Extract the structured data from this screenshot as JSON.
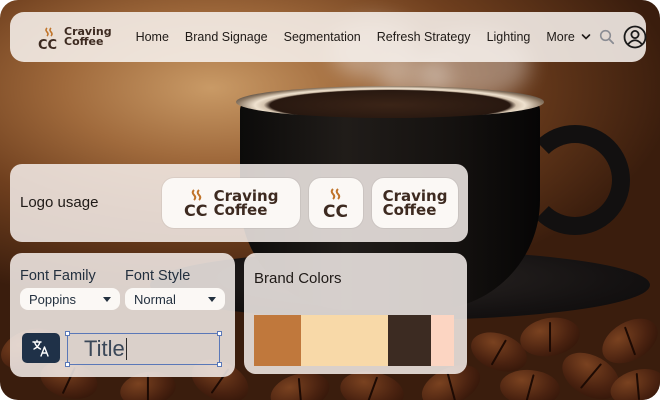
{
  "brand": {
    "logo_line1": "Craving",
    "logo_line2": "Coffee",
    "logo_initials": "CC"
  },
  "nav": {
    "links": [
      "Home",
      "Brand Signage",
      "Segmentation",
      "Refresh Strategy",
      "Lighting"
    ],
    "more_label": "More"
  },
  "logo_usage": {
    "title": "Logo usage"
  },
  "typography": {
    "font_family_label": "Font Family",
    "font_family_value": "Poppins",
    "font_style_label": "Font Style",
    "font_style_value": "Normal",
    "title_text": "Title"
  },
  "brand_colors": {
    "title": "Brand Colors",
    "swatches": [
      {
        "hex": "#c0783c"
      },
      {
        "hex": "#f8d9a8"
      },
      {
        "hex": "#3c2b22"
      },
      {
        "hex": "#fcd5c2"
      }
    ]
  },
  "icons": {
    "search": "search-icon",
    "account": "user-account-icon",
    "translate": "translate-icon",
    "more": "chevron-down-icon"
  },
  "colors": {
    "brand_brown": "#3d2a20",
    "accent_orange": "#c0742b",
    "button_navy": "#1f3148"
  }
}
